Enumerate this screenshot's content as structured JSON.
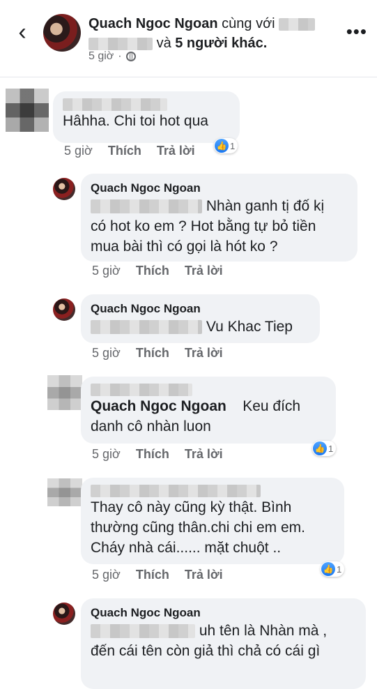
{
  "header": {
    "author": "Quach Ngoc Ngoan",
    "with_text": "cùng với",
    "and_text": "và",
    "others": "5 người khác.",
    "time": "5 giờ",
    "dot": "·",
    "back_icon": "chevron-left-icon",
    "more_icon": "more-horizontal-icon",
    "privacy_icon": "globe-icon"
  },
  "labels": {
    "like": "Thích",
    "reply": "Trả lời"
  },
  "comments": [
    {
      "name": "",
      "text": "Hâhha. Chi toi hot qua",
      "time": "5 giờ",
      "reactions": "1"
    },
    {
      "name": "Quach Ngoc Ngoan",
      "text_line1": "Nhàn ganh tị đố kị",
      "text_line2": "có hot ko em ? Hot bằng tự bỏ tiền",
      "text_line3": "mua bài thì có gọi là hót ko ?",
      "time": "5 giờ"
    },
    {
      "name": "Quach Ngoc Ngoan",
      "text": "Vu Khac Tiep",
      "time": "5 giờ"
    },
    {
      "name": "",
      "mention": "Quach Ngoc Ngoan",
      "text_line1": "Keu đích",
      "text_line2": "danh cô nhàn luon",
      "time": "5 giờ",
      "reactions": "1"
    },
    {
      "name": "",
      "text_line1": "Thay cô này cũng kỳ thật. Bình",
      "text_line2": "thường cũng thân.chi chi em em.",
      "text_line3": "Cháy nhà cái...... mặt chuột ..",
      "time": "5 giờ",
      "reactions": "1"
    },
    {
      "name": "Quach Ngoc Ngoan",
      "text_line1": "uh tên là Nhàn mà ,",
      "text_line2": "đến cái tên còn giả thì chả có cái gì"
    }
  ],
  "colors": {
    "bubble": "#f0f2f5",
    "meta": "#65676b",
    "like_blue": "#1877f2"
  }
}
